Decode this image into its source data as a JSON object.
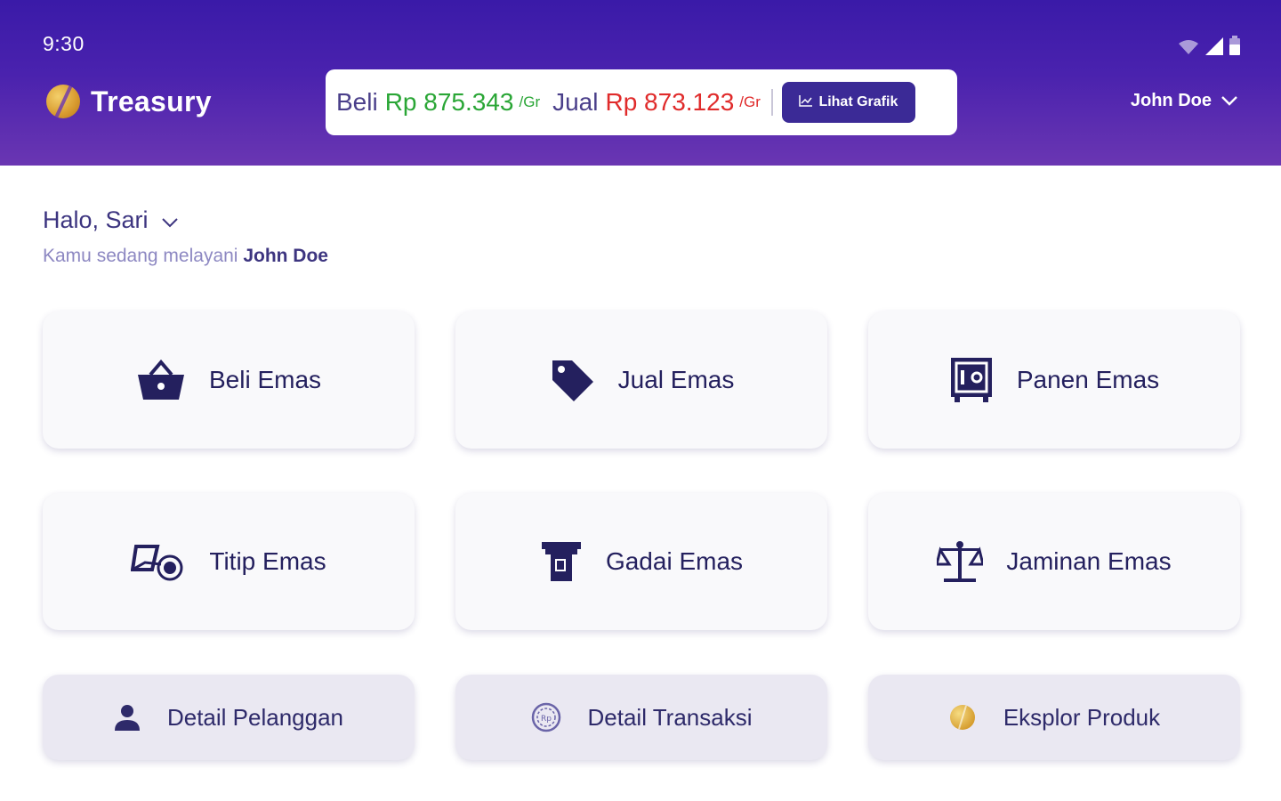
{
  "status_bar": {
    "time": "9:30"
  },
  "header": {
    "brand": "Treasury",
    "price": {
      "buy_label": "Beli",
      "buy_value": "Rp 875.343",
      "buy_unit": "/Gr",
      "sell_label": "Jual",
      "sell_value": "Rp 873.123",
      "sell_unit": "/Gr",
      "chart_button": "Lihat Grafik"
    },
    "user_name": "John Doe"
  },
  "greeting": {
    "title": "Halo, Sari",
    "subtitle_prefix": "Kamu sedang melayani",
    "subtitle_name": "John Doe"
  },
  "menu": {
    "beli": "Beli Emas",
    "jual": "Jual Emas",
    "panen": "Panen Emas",
    "titip": "Titip Emas",
    "gadai": "Gadai Emas",
    "jaminan": "Jaminan Emas"
  },
  "quick_links": {
    "pelanggan": "Detail Pelanggan",
    "transaksi": "Detail Transaksi",
    "eksplor": "Eksplor Produk"
  },
  "colors": {
    "header_top": "#3a1aa8",
    "header_bottom": "#6a36b2",
    "buy": "#2aa636",
    "sell": "#e02b2b",
    "accent": "#24205e"
  },
  "icons": {
    "beli": "basket-icon",
    "jual": "price-tag-icon",
    "panen": "safe-icon",
    "titip": "hand-coin-icon",
    "gadai": "atm-icon",
    "jaminan": "scale-icon",
    "pelanggan": "person-icon",
    "transaksi": "coin-icon",
    "eksplor": "gold-coin-icon"
  }
}
